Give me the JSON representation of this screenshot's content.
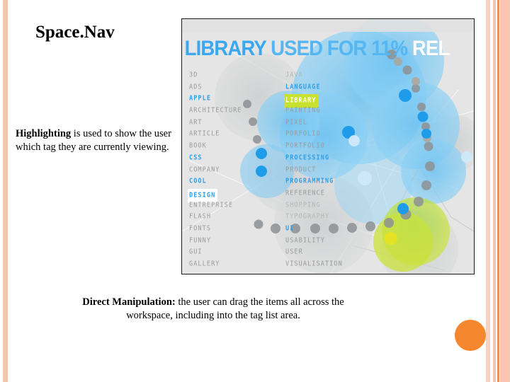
{
  "slide": {
    "title": "Space.Nav",
    "note_strong": "Highlighting",
    "note_rest": " is used to show the user which tag they are currently viewing.",
    "bottom_strong": "Direct Manipulation:",
    "bottom_rest": " the user can drag the items all across the workspace, including into the tag list area."
  },
  "app": {
    "headline": {
      "part1": "LIBRARY ",
      "part2": "USED FOR 11% ",
      "part3": "RELATED"
    },
    "tags_left": [
      {
        "label": "3D",
        "state": "normal"
      },
      {
        "label": "ADS",
        "state": "normal"
      },
      {
        "label": "APPLE",
        "state": "blue"
      },
      {
        "label": "ARCHITECTURE",
        "state": "normal"
      },
      {
        "label": "ART",
        "state": "normal"
      },
      {
        "label": "ARTICLE",
        "state": "normal"
      },
      {
        "label": "BOOK",
        "state": "normal"
      },
      {
        "label": "CSS",
        "state": "blue"
      },
      {
        "label": "COMPANY",
        "state": "normal"
      },
      {
        "label": "COOL",
        "state": "blue"
      },
      {
        "label": "DESIGN",
        "state": "selected-white"
      },
      {
        "label": "ENTREPRISE",
        "state": "normal"
      },
      {
        "label": "FLASH",
        "state": "normal"
      },
      {
        "label": "FONTS",
        "state": "normal"
      },
      {
        "label": "FUNNY",
        "state": "normal"
      },
      {
        "label": "GUI",
        "state": "normal"
      },
      {
        "label": "GALLERY",
        "state": "normal"
      }
    ],
    "tags_right": [
      {
        "label": "JAVA",
        "state": "dim"
      },
      {
        "label": "LANGUAGE",
        "state": "blue"
      },
      {
        "label": "LIBRARY",
        "state": "selected-green"
      },
      {
        "label": "PAINTING",
        "state": "normal"
      },
      {
        "label": "PIXEL",
        "state": "normal"
      },
      {
        "label": "PORFOLIO",
        "state": "normal"
      },
      {
        "label": "PORTFOLIO",
        "state": "normal"
      },
      {
        "label": "PROCESSING",
        "state": "blue"
      },
      {
        "label": "PRODUCT",
        "state": "normal"
      },
      {
        "label": "PROGRAMMING",
        "state": "blue"
      },
      {
        "label": "REFERENCE",
        "state": "normal"
      },
      {
        "label": "SHOPPING",
        "state": "dim"
      },
      {
        "label": "TYPOGRAPHY",
        "state": "dim"
      },
      {
        "label": "UI",
        "state": "blue"
      },
      {
        "label": "USABILITY",
        "state": "normal"
      },
      {
        "label": "USER",
        "state": "normal"
      },
      {
        "label": "VISUALISATION",
        "state": "normal"
      }
    ]
  },
  "colors": {
    "accent_blue": "#2f9fe8",
    "highlight_green": "#c6e22e",
    "panel_bg": "#e3e3e3",
    "stripe_peach": "#f6c3ab",
    "stripe_orange": "#e8915f",
    "bullet_orange": "#f5872e"
  }
}
